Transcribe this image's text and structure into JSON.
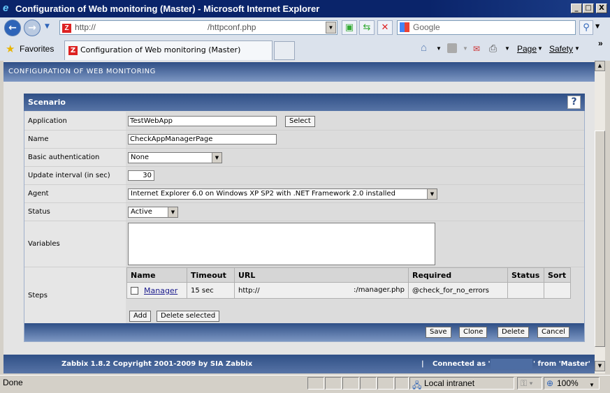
{
  "window": {
    "title": "Configuration of Web monitoring (Master) - Microsoft Internet Explorer",
    "min": "_",
    "max": "□",
    "close": "X"
  },
  "nav": {
    "address_prefix": "http://",
    "address_suffix": "/httpconf.php",
    "search_placeholder": "Google"
  },
  "tabs": {
    "favorites": "Favorites",
    "active_tab": "Configuration of Web monitoring (Master)",
    "page_menu": "Page",
    "safety_menu": "Safety",
    "more": "»"
  },
  "page": {
    "header": "CONFIGURATION OF WEB MONITORING"
  },
  "form": {
    "title": "Scenario",
    "help": "?",
    "application": {
      "label": "Application",
      "value": "TestWebApp",
      "select_button": "Select"
    },
    "name": {
      "label": "Name",
      "value": "CheckAppManagerPage"
    },
    "basic_auth": {
      "label": "Basic authentication",
      "value": "None"
    },
    "update_interval": {
      "label": "Update interval (in sec)",
      "value": "30"
    },
    "agent": {
      "label": "Agent",
      "value": "Internet Explorer 6.0 on Windows XP SP2 with .NET Framework 2.0 installed"
    },
    "status": {
      "label": "Status",
      "value": "Active"
    },
    "variables": {
      "label": "Variables",
      "value": ""
    },
    "steps": {
      "label": "Steps",
      "columns": [
        "Name",
        "Timeout",
        "URL",
        "Required",
        "Status",
        "Sort"
      ],
      "rows": [
        {
          "name": "Manager",
          "timeout": "15 sec",
          "url_prefix": "http://",
          "url_suffix": ":/manager.php",
          "required": "@check_for_no_errors",
          "status": "",
          "sort": ""
        }
      ],
      "add": "Add",
      "delete_selected": "Delete selected"
    },
    "buttons": {
      "save": "Save",
      "clone": "Clone",
      "delete": "Delete",
      "cancel": "Cancel"
    }
  },
  "footer": {
    "copyright": "Zabbix 1.8.2 Copyright 2001-2009 by SIA Zabbix",
    "connected_prefix": "Connected as '",
    "connected_suffix": "' from 'Master'"
  },
  "statusbar": {
    "status": "Done",
    "zone": "Local intranet",
    "zoom": "100%"
  }
}
